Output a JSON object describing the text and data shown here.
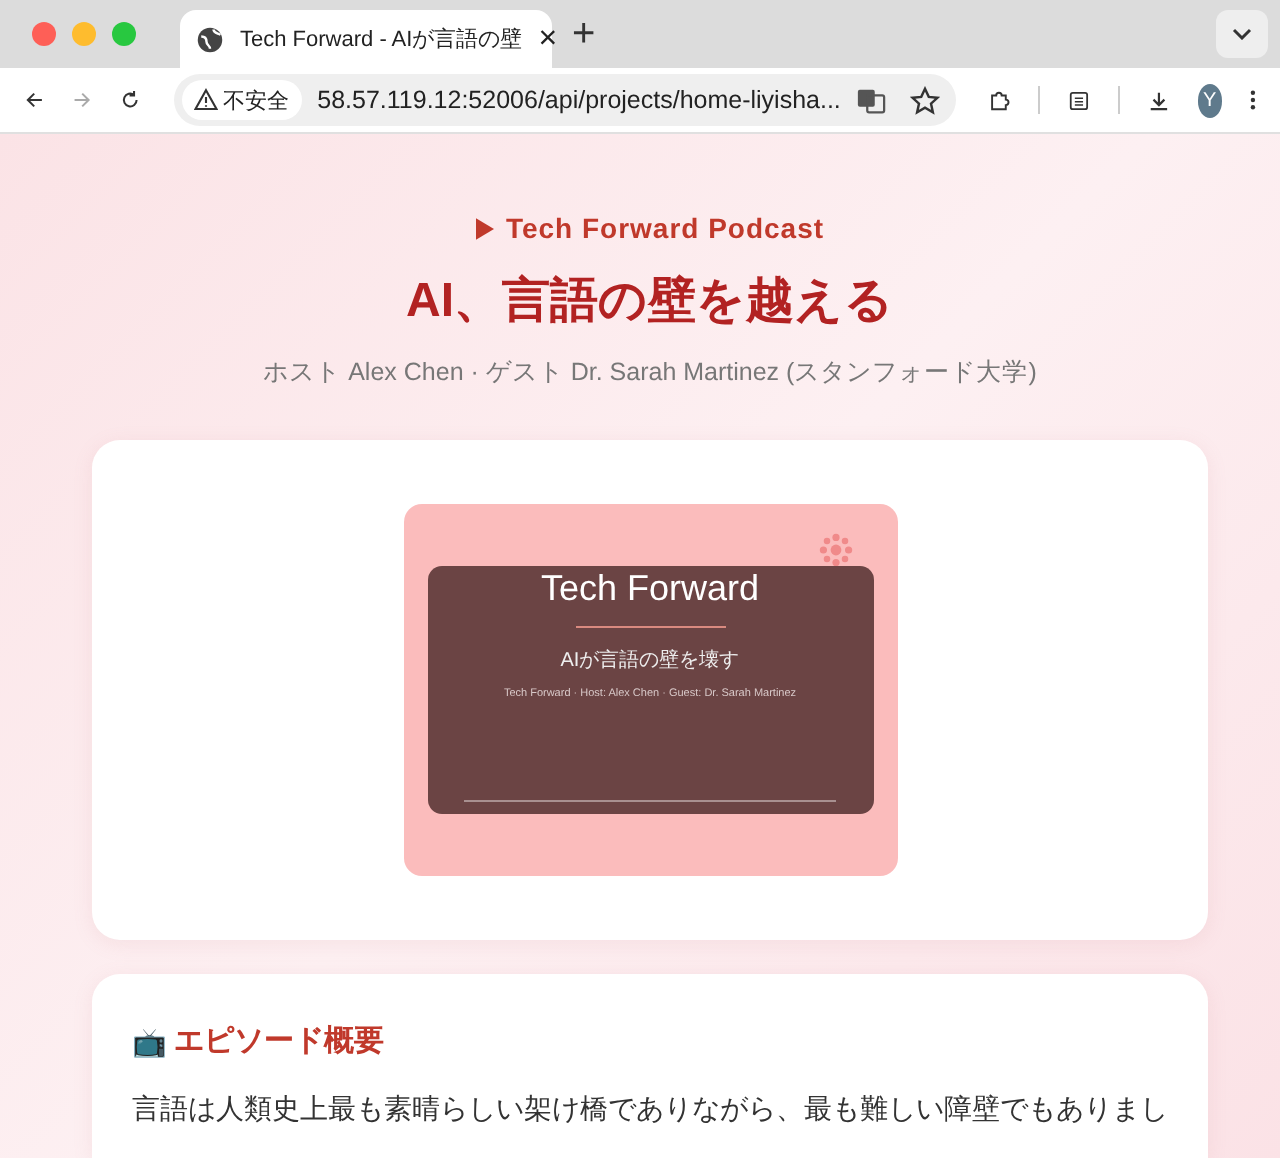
{
  "browser": {
    "tab": {
      "title": "Tech Forward - AIが言語の壁",
      "close": "×"
    },
    "new_tab": "+",
    "security_label": "不安全",
    "url": "58.57.119.12:52006/api/projects/home-liyisha...",
    "profile_initial": "Y"
  },
  "header": {
    "series": "Tech Forward Podcast",
    "title": "AI、言語の壁を越える",
    "credits": "ホスト Alex Chen · ゲスト Dr. Sarah Martinez (スタンフォード大学)"
  },
  "cover": {
    "title": "Tech Forward",
    "subtitle": "AIが言語の壁を壊す",
    "byline": "Tech Forward · Host: Alex Chen · Guest: Dr. Sarah Martinez"
  },
  "summary": {
    "icon": "📺",
    "heading": "エピソード概要",
    "text": "言語は人類史上最も素晴らしい架け橋でありながら、最も難しい障壁でもありまし"
  }
}
